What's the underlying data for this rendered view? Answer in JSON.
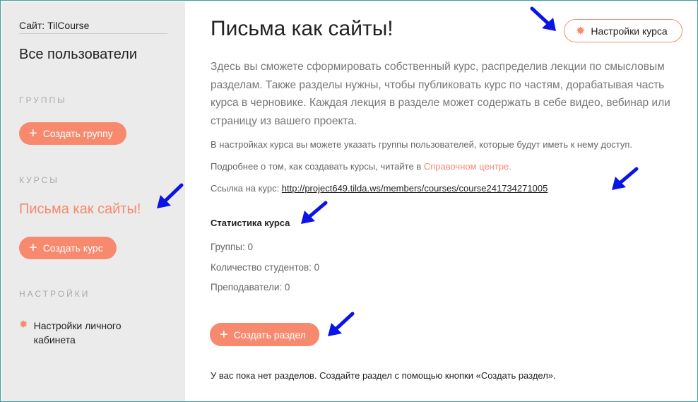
{
  "sidebar": {
    "site_label": "Сайт: TilCourse",
    "all_users": "Все пользователи",
    "groups_heading": "ГРУППЫ",
    "create_group_label": "Создать группу",
    "courses_heading": "КУРСЫ",
    "current_course": "Письма как сайты!",
    "create_course_label": "Создать курс",
    "settings_heading": "НАСТРОЙКИ",
    "account_settings_label": "Настройки личного кабинета"
  },
  "main": {
    "title": "Письма как сайты!",
    "settings_button_label": "Настройки курса",
    "intro": "Здесь вы сможете сформировать собственный курс, распределив лекции по смысловым разделам. Также разделы нужны, чтобы публиковать курс по частям, дорабатывая часть курса в черновике. Каждая лекция в разделе может содержать в себе видео, вебинар или страницу из вашего проекта.",
    "groups_note": "В настройках курса вы можете указать группы пользователей, которые будут иметь к нему доступ.",
    "help_note_prefix": "Подробнее о том, как создавать курсы, читайте в ",
    "help_link": "Справочном центре.",
    "course_link_label": "Ссылка на курс: ",
    "course_url": "http://project649.tilda.ws/members/courses/course241734271005",
    "stats_title": "Статистика курса",
    "stats_groups": "Группы:  0",
    "stats_students": "Количество студентов: 0",
    "stats_teachers": "Преподаватели:  0",
    "create_section_label": "Создать раздел",
    "empty_sections_note": "У вас пока нет разделов. Создайте раздел с помощью кнопки «Создать раздел»."
  },
  "colors": {
    "accent": "#f78a6e",
    "sidebar_bg": "#ebebeb",
    "annotation_arrow": "#0a14e6"
  }
}
